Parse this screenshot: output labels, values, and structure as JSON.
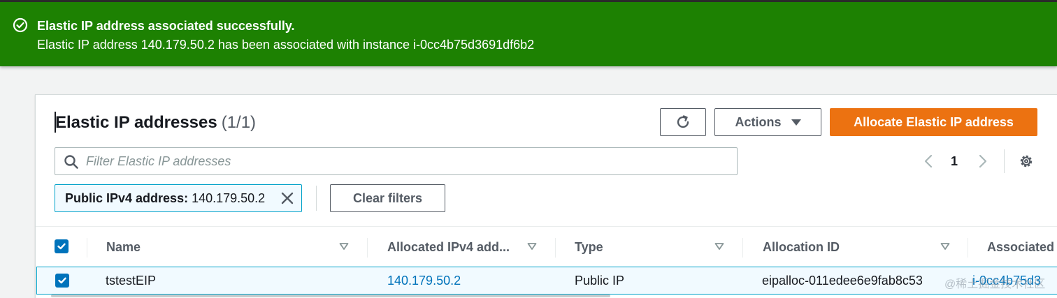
{
  "flash": {
    "title": "Elastic IP address associated successfully.",
    "message": "Elastic IP address 140.179.50.2 has been associated with instance i-0cc4b75d3691df6b2",
    "status_color": "#1d8102",
    "icon": "check-circle-icon"
  },
  "header": {
    "title": "Elastic IP addresses",
    "count": "(1/1)"
  },
  "toolbar": {
    "refresh_icon": "refresh-icon",
    "actions_label": "Actions",
    "allocate_label": "Allocate Elastic IP address",
    "accent_color": "#ec7211"
  },
  "search": {
    "placeholder": "Filter Elastic IP addresses",
    "value": ""
  },
  "pagination": {
    "current_page": "1"
  },
  "filter_token": {
    "key": "Public IPv4 address:",
    "value": "140.179.50.2"
  },
  "clear_filters_label": "Clear filters",
  "table": {
    "columns": [
      "Name",
      "Allocated IPv4 add...",
      "Type",
      "Allocation ID",
      "Associated"
    ],
    "rows": [
      {
        "selected": true,
        "name": "tstestEIP",
        "ipv4": "140.179.50.2",
        "type": "Public IP",
        "allocation_id": "eipalloc-011edee6e9fab8c53",
        "associated": "i-0cc4b75d3"
      }
    ]
  },
  "watermark": "@稀土掘金技术社区"
}
